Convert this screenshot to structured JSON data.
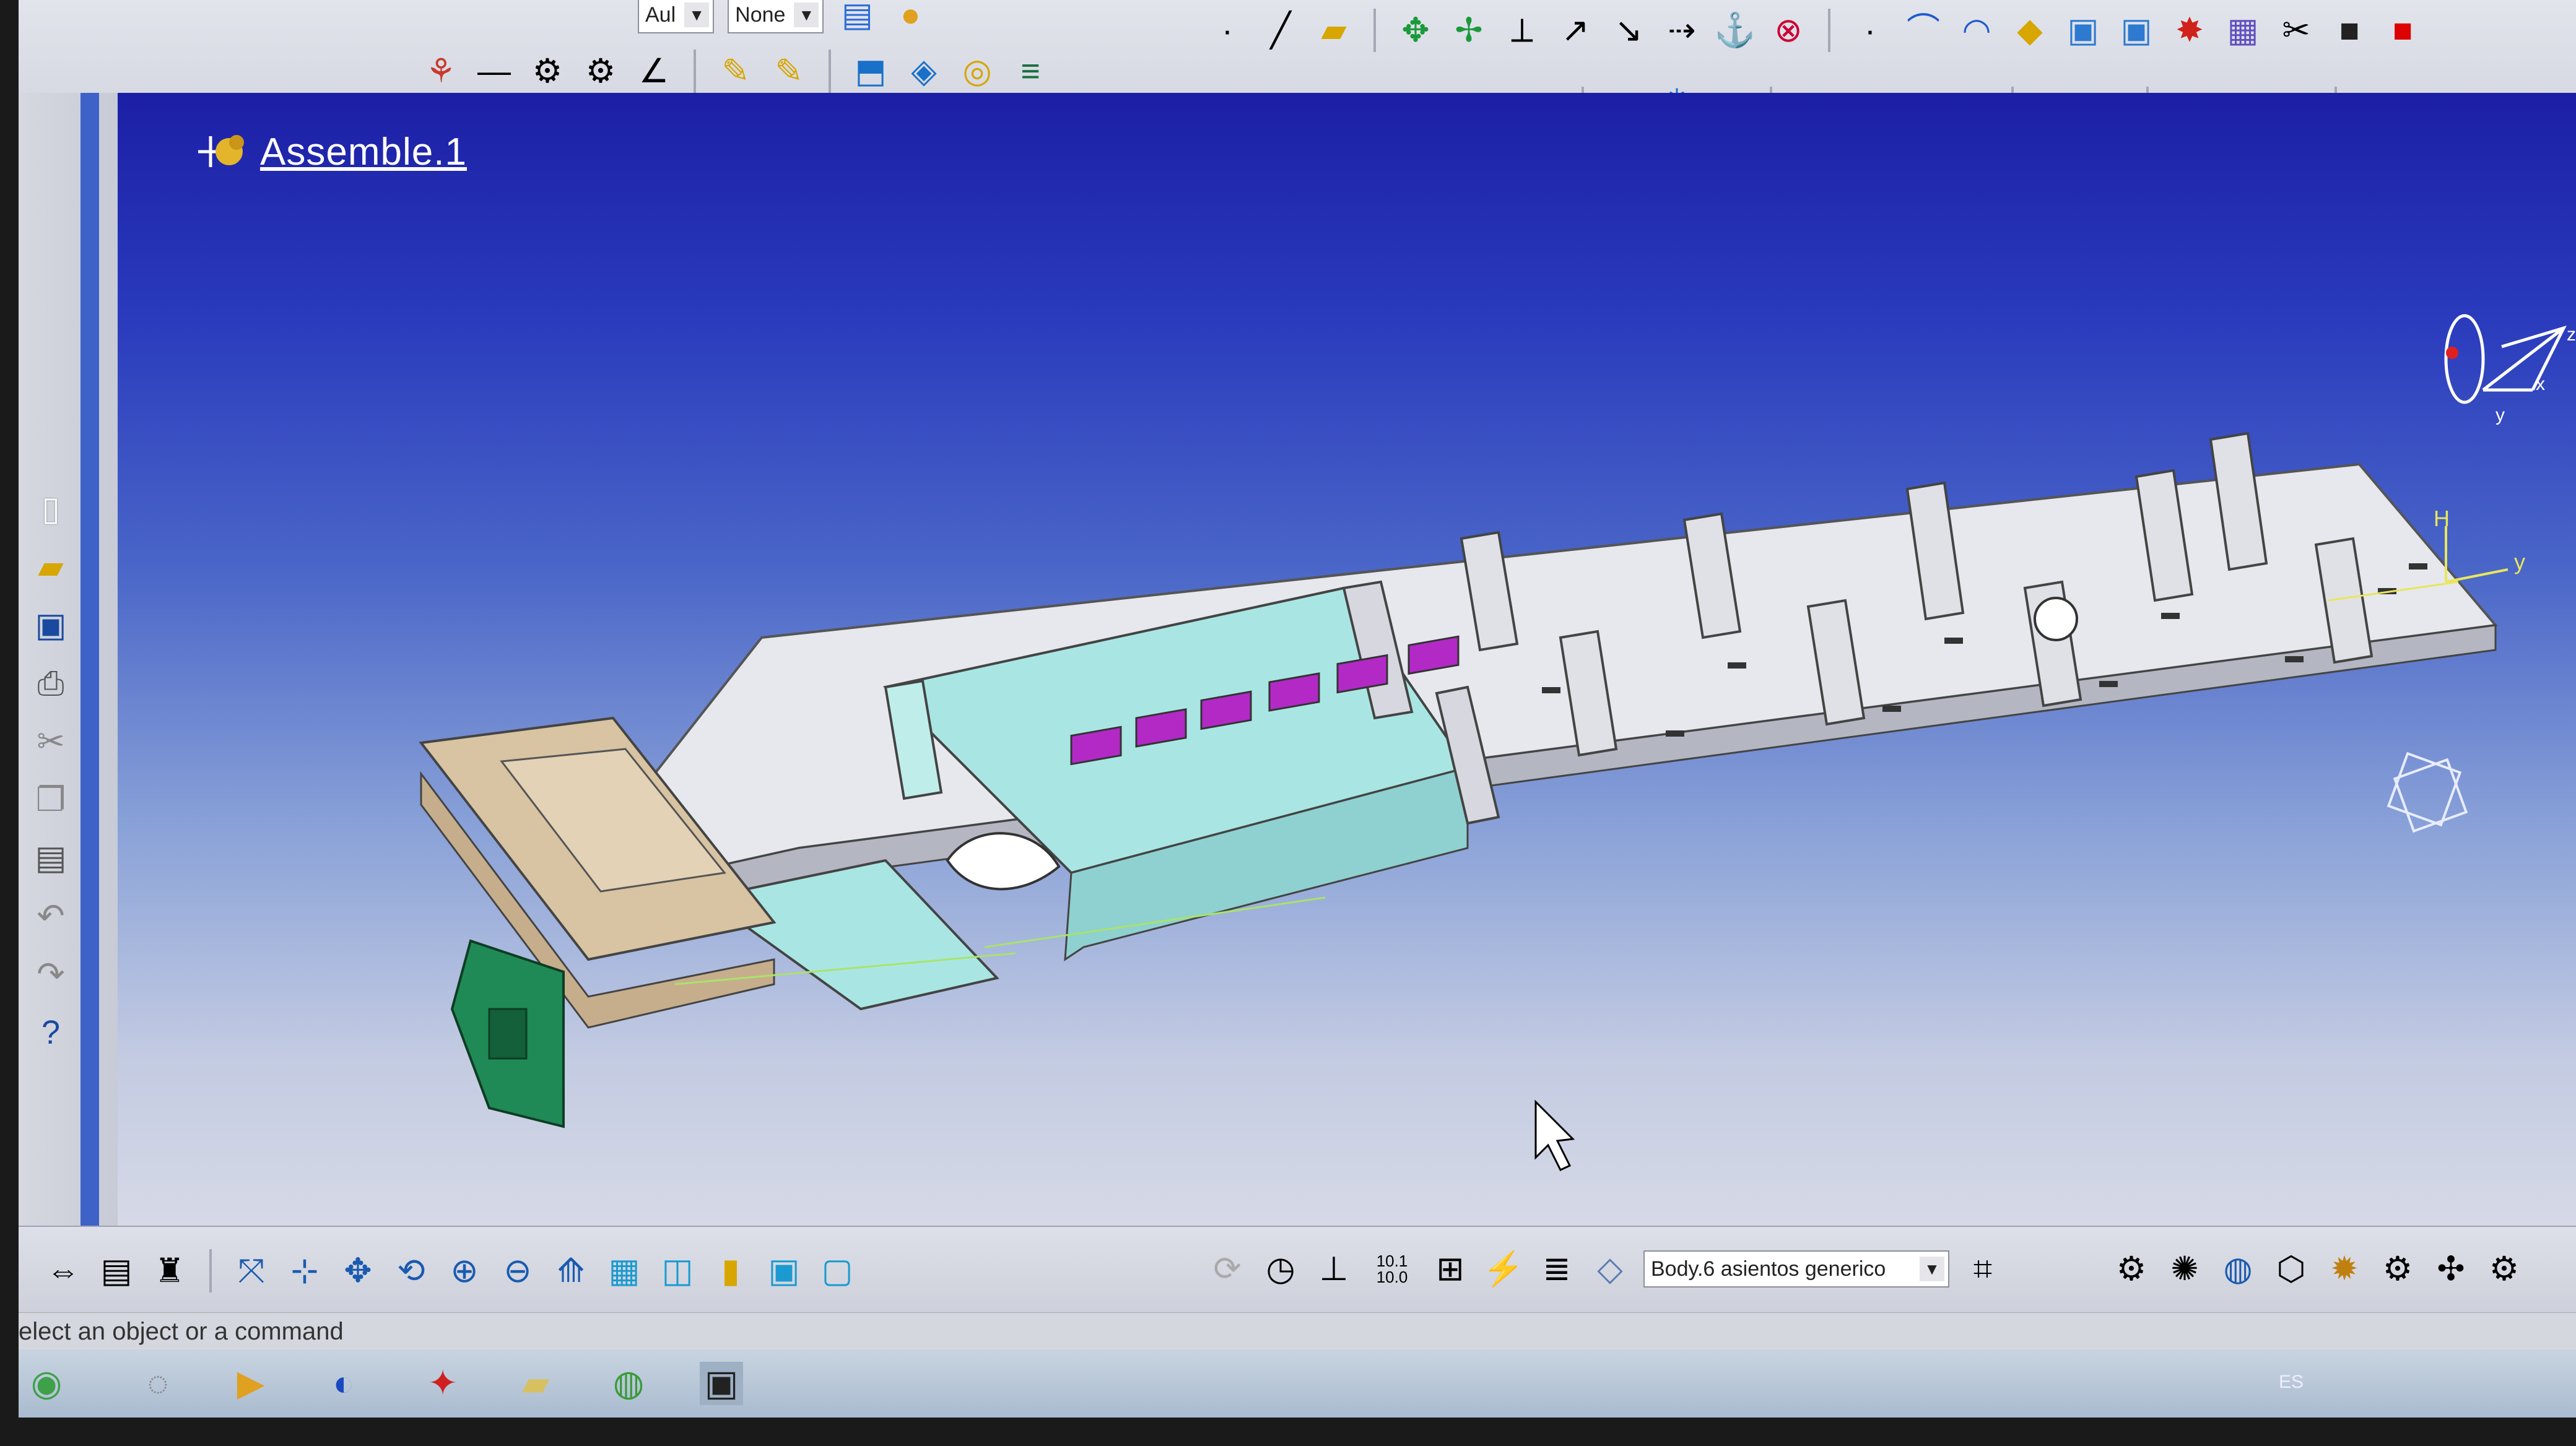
{
  "toolbar": {
    "combo_a": "Aul",
    "combo_b": "None"
  },
  "tree": {
    "root_label": "Assemble.1"
  },
  "bottom": {
    "current_body": "Body.6 asientos generico",
    "scale_readout": "10.1\n10.0"
  },
  "status": {
    "text": "elect an object or a command"
  },
  "axis": {
    "x": "x",
    "y": "y",
    "z": "z",
    "h": "H"
  },
  "taskbar": {
    "lang": "ES"
  },
  "icons": [
    "start-orb-icon",
    "browser-icon",
    "media-icon",
    "catia-icon",
    "folder-icon",
    "chrome-icon",
    "app-window-icon"
  ],
  "colors": {
    "base_plate": "#e8e8ec",
    "cabin_fill": "#a8e6e2",
    "seat_fill": "#b52cc4",
    "front_block": "#d8c2a0",
    "green_part": "#1f8a55"
  }
}
